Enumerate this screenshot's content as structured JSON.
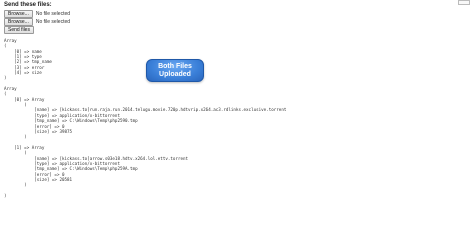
{
  "form": {
    "title": "Send these files:",
    "files": [
      {
        "button_label": "Browse...",
        "status": "No file selected"
      },
      {
        "button_label": "Browse...",
        "status": "No file selected"
      }
    ],
    "submit_label": "Send files"
  },
  "dump": {
    "lines": [
      "Array",
      "(",
      "    [0] => name",
      "    [1] => type",
      "    [2] => tmp_name",
      "    [3] => error",
      "    [4] => size",
      ")",
      "",
      "Array",
      "(",
      "    [0] => Array",
      "        (",
      "            [name] => [kickass.to]run.raja.run.2014.telugu.movie.720p.hdtvrip.x264.ac3.rdlinks.exclusive.torrent",
      "            [type] => application/x-bittorrent",
      "            [tmp_name] => C:\\Windows\\Temp\\php2590.tmp",
      "            [error] => 0",
      "            [size] => 39875",
      "        )",
      "",
      "    [1] => Array",
      "        (",
      "            [name] => [kickass.to]arrow.s03e18.hdtv.x264.lol.ettv.torrent",
      "            [type] => application/x-bittorrent",
      "            [tmp_name] => C:\\Windows\\Temp\\php259A.tmp",
      "            [error] => 0",
      "            [size] => 20581",
      "        )",
      "",
      ")"
    ]
  },
  "badge": {
    "line1": "Both Files",
    "line2": "Uploaded",
    "color": "#3a7fd8"
  }
}
